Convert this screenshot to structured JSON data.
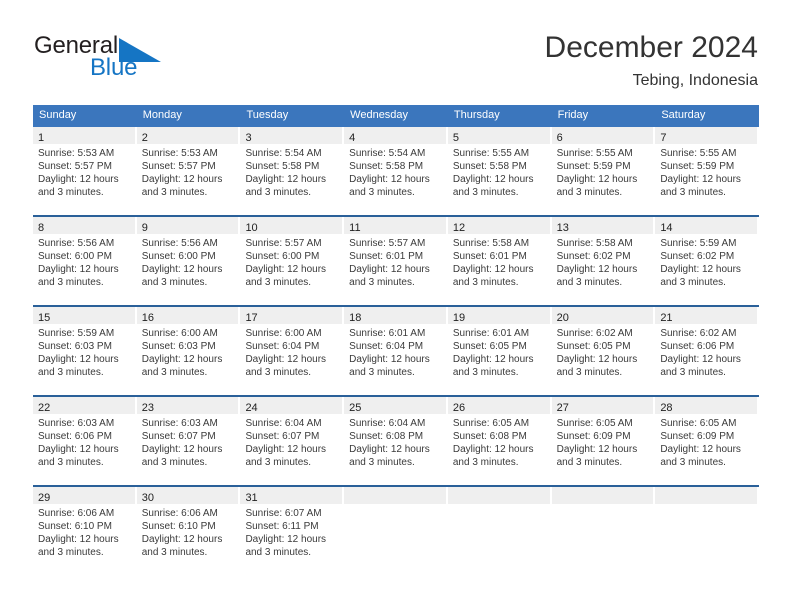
{
  "brand": {
    "name_part1": "General",
    "name_part2": "Blue",
    "triangle_color": "#1575c4"
  },
  "header": {
    "title": "December 2024",
    "subtitle": "Tebing, Indonesia"
  },
  "colors": {
    "header_blue": "#3b76bd",
    "row_border_blue": "#2a6099",
    "day_band_gray": "#efefef",
    "text": "#3a3a3a"
  },
  "weekday_headers": [
    "Sunday",
    "Monday",
    "Tuesday",
    "Wednesday",
    "Thursday",
    "Friday",
    "Saturday"
  ],
  "weeks": [
    [
      {
        "day": "1",
        "sunrise": "Sunrise: 5:53 AM",
        "sunset": "Sunset: 5:57 PM",
        "daylight1": "Daylight: 12 hours",
        "daylight2": "and 3 minutes."
      },
      {
        "day": "2",
        "sunrise": "Sunrise: 5:53 AM",
        "sunset": "Sunset: 5:57 PM",
        "daylight1": "Daylight: 12 hours",
        "daylight2": "and 3 minutes."
      },
      {
        "day": "3",
        "sunrise": "Sunrise: 5:54 AM",
        "sunset": "Sunset: 5:58 PM",
        "daylight1": "Daylight: 12 hours",
        "daylight2": "and 3 minutes."
      },
      {
        "day": "4",
        "sunrise": "Sunrise: 5:54 AM",
        "sunset": "Sunset: 5:58 PM",
        "daylight1": "Daylight: 12 hours",
        "daylight2": "and 3 minutes."
      },
      {
        "day": "5",
        "sunrise": "Sunrise: 5:55 AM",
        "sunset": "Sunset: 5:58 PM",
        "daylight1": "Daylight: 12 hours",
        "daylight2": "and 3 minutes."
      },
      {
        "day": "6",
        "sunrise": "Sunrise: 5:55 AM",
        "sunset": "Sunset: 5:59 PM",
        "daylight1": "Daylight: 12 hours",
        "daylight2": "and 3 minutes."
      },
      {
        "day": "7",
        "sunrise": "Sunrise: 5:55 AM",
        "sunset": "Sunset: 5:59 PM",
        "daylight1": "Daylight: 12 hours",
        "daylight2": "and 3 minutes."
      }
    ],
    [
      {
        "day": "8",
        "sunrise": "Sunrise: 5:56 AM",
        "sunset": "Sunset: 6:00 PM",
        "daylight1": "Daylight: 12 hours",
        "daylight2": "and 3 minutes."
      },
      {
        "day": "9",
        "sunrise": "Sunrise: 5:56 AM",
        "sunset": "Sunset: 6:00 PM",
        "daylight1": "Daylight: 12 hours",
        "daylight2": "and 3 minutes."
      },
      {
        "day": "10",
        "sunrise": "Sunrise: 5:57 AM",
        "sunset": "Sunset: 6:00 PM",
        "daylight1": "Daylight: 12 hours",
        "daylight2": "and 3 minutes."
      },
      {
        "day": "11",
        "sunrise": "Sunrise: 5:57 AM",
        "sunset": "Sunset: 6:01 PM",
        "daylight1": "Daylight: 12 hours",
        "daylight2": "and 3 minutes."
      },
      {
        "day": "12",
        "sunrise": "Sunrise: 5:58 AM",
        "sunset": "Sunset: 6:01 PM",
        "daylight1": "Daylight: 12 hours",
        "daylight2": "and 3 minutes."
      },
      {
        "day": "13",
        "sunrise": "Sunrise: 5:58 AM",
        "sunset": "Sunset: 6:02 PM",
        "daylight1": "Daylight: 12 hours",
        "daylight2": "and 3 minutes."
      },
      {
        "day": "14",
        "sunrise": "Sunrise: 5:59 AM",
        "sunset": "Sunset: 6:02 PM",
        "daylight1": "Daylight: 12 hours",
        "daylight2": "and 3 minutes."
      }
    ],
    [
      {
        "day": "15",
        "sunrise": "Sunrise: 5:59 AM",
        "sunset": "Sunset: 6:03 PM",
        "daylight1": "Daylight: 12 hours",
        "daylight2": "and 3 minutes."
      },
      {
        "day": "16",
        "sunrise": "Sunrise: 6:00 AM",
        "sunset": "Sunset: 6:03 PM",
        "daylight1": "Daylight: 12 hours",
        "daylight2": "and 3 minutes."
      },
      {
        "day": "17",
        "sunrise": "Sunrise: 6:00 AM",
        "sunset": "Sunset: 6:04 PM",
        "daylight1": "Daylight: 12 hours",
        "daylight2": "and 3 minutes."
      },
      {
        "day": "18",
        "sunrise": "Sunrise: 6:01 AM",
        "sunset": "Sunset: 6:04 PM",
        "daylight1": "Daylight: 12 hours",
        "daylight2": "and 3 minutes."
      },
      {
        "day": "19",
        "sunrise": "Sunrise: 6:01 AM",
        "sunset": "Sunset: 6:05 PM",
        "daylight1": "Daylight: 12 hours",
        "daylight2": "and 3 minutes."
      },
      {
        "day": "20",
        "sunrise": "Sunrise: 6:02 AM",
        "sunset": "Sunset: 6:05 PM",
        "daylight1": "Daylight: 12 hours",
        "daylight2": "and 3 minutes."
      },
      {
        "day": "21",
        "sunrise": "Sunrise: 6:02 AM",
        "sunset": "Sunset: 6:06 PM",
        "daylight1": "Daylight: 12 hours",
        "daylight2": "and 3 minutes."
      }
    ],
    [
      {
        "day": "22",
        "sunrise": "Sunrise: 6:03 AM",
        "sunset": "Sunset: 6:06 PM",
        "daylight1": "Daylight: 12 hours",
        "daylight2": "and 3 minutes."
      },
      {
        "day": "23",
        "sunrise": "Sunrise: 6:03 AM",
        "sunset": "Sunset: 6:07 PM",
        "daylight1": "Daylight: 12 hours",
        "daylight2": "and 3 minutes."
      },
      {
        "day": "24",
        "sunrise": "Sunrise: 6:04 AM",
        "sunset": "Sunset: 6:07 PM",
        "daylight1": "Daylight: 12 hours",
        "daylight2": "and 3 minutes."
      },
      {
        "day": "25",
        "sunrise": "Sunrise: 6:04 AM",
        "sunset": "Sunset: 6:08 PM",
        "daylight1": "Daylight: 12 hours",
        "daylight2": "and 3 minutes."
      },
      {
        "day": "26",
        "sunrise": "Sunrise: 6:05 AM",
        "sunset": "Sunset: 6:08 PM",
        "daylight1": "Daylight: 12 hours",
        "daylight2": "and 3 minutes."
      },
      {
        "day": "27",
        "sunrise": "Sunrise: 6:05 AM",
        "sunset": "Sunset: 6:09 PM",
        "daylight1": "Daylight: 12 hours",
        "daylight2": "and 3 minutes."
      },
      {
        "day": "28",
        "sunrise": "Sunrise: 6:05 AM",
        "sunset": "Sunset: 6:09 PM",
        "daylight1": "Daylight: 12 hours",
        "daylight2": "and 3 minutes."
      }
    ],
    [
      {
        "day": "29",
        "sunrise": "Sunrise: 6:06 AM",
        "sunset": "Sunset: 6:10 PM",
        "daylight1": "Daylight: 12 hours",
        "daylight2": "and 3 minutes."
      },
      {
        "day": "30",
        "sunrise": "Sunrise: 6:06 AM",
        "sunset": "Sunset: 6:10 PM",
        "daylight1": "Daylight: 12 hours",
        "daylight2": "and 3 minutes."
      },
      {
        "day": "31",
        "sunrise": "Sunrise: 6:07 AM",
        "sunset": "Sunset: 6:11 PM",
        "daylight1": "Daylight: 12 hours",
        "daylight2": "and 3 minutes."
      },
      {
        "day": "",
        "sunrise": "",
        "sunset": "",
        "daylight1": "",
        "daylight2": ""
      },
      {
        "day": "",
        "sunrise": "",
        "sunset": "",
        "daylight1": "",
        "daylight2": ""
      },
      {
        "day": "",
        "sunrise": "",
        "sunset": "",
        "daylight1": "",
        "daylight2": ""
      },
      {
        "day": "",
        "sunrise": "",
        "sunset": "",
        "daylight1": "",
        "daylight2": ""
      }
    ]
  ]
}
